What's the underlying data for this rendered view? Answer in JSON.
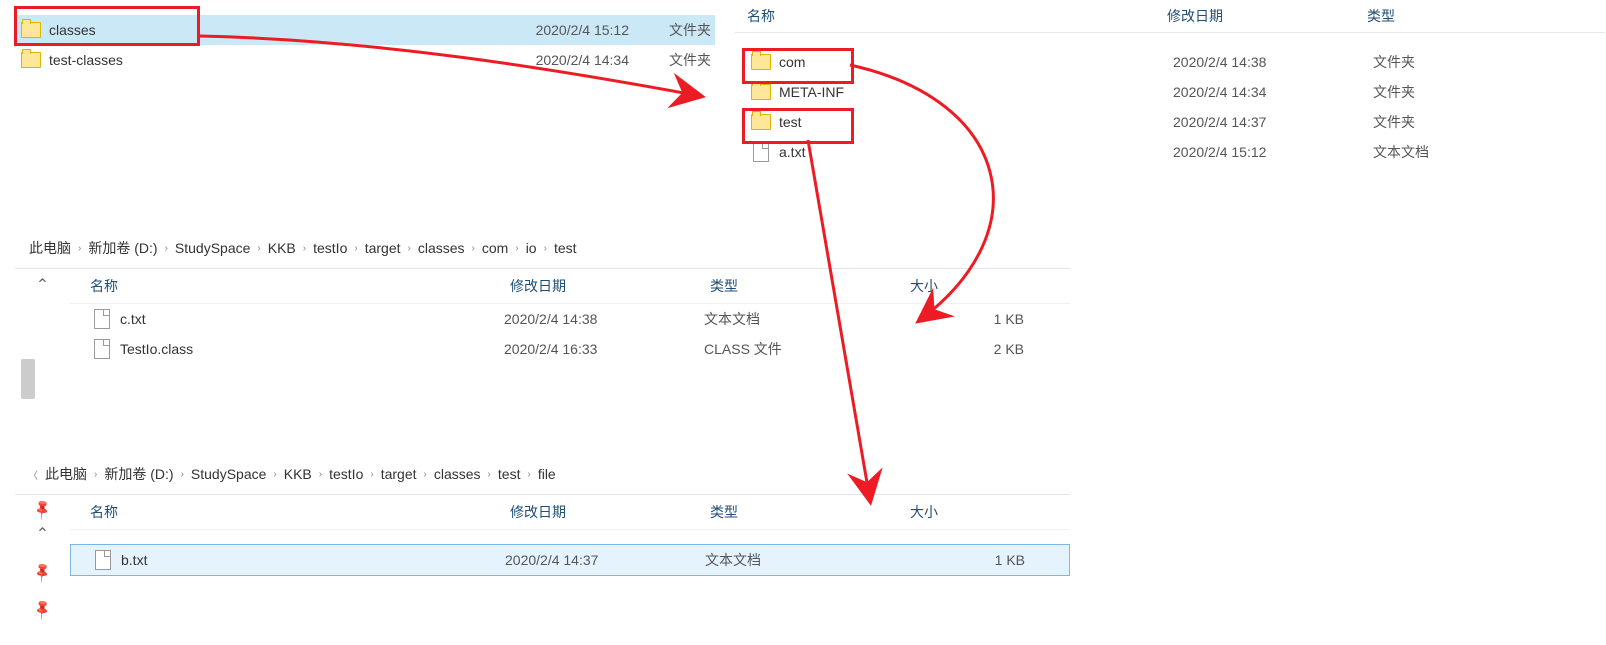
{
  "panel1": {
    "rows": [
      {
        "name": "classes",
        "date": "2020/2/4 15:12",
        "type": "文件夹",
        "icon": "folder",
        "selected": true
      },
      {
        "name": "test-classes",
        "date": "2020/2/4 14:34",
        "type": "文件夹",
        "icon": "folder",
        "selected": false
      }
    ]
  },
  "panel2": {
    "headers": {
      "name": "名称",
      "date": "修改日期",
      "type": "类型"
    },
    "rows": [
      {
        "name": "com",
        "date": "2020/2/4 14:38",
        "type": "文件夹",
        "icon": "folder"
      },
      {
        "name": "META-INF",
        "date": "2020/2/4 14:34",
        "type": "文件夹",
        "icon": "folder"
      },
      {
        "name": "test",
        "date": "2020/2/4 14:37",
        "type": "文件夹",
        "icon": "folder"
      },
      {
        "name": "a.txt",
        "date": "2020/2/4 15:12",
        "type": "文本文档",
        "icon": "file"
      }
    ]
  },
  "crumb1": [
    "此电脑",
    "新加卷 (D:)",
    "StudySpace",
    "KKB",
    "testIo",
    "target",
    "classes",
    "com",
    "io",
    "test"
  ],
  "panel3": {
    "headers": {
      "name": "名称",
      "date": "修改日期",
      "type": "类型",
      "size": "大小"
    },
    "rows": [
      {
        "name": "c.txt",
        "date": "2020/2/4 14:38",
        "type": "文本文档",
        "size": "1 KB",
        "icon": "file"
      },
      {
        "name": "TestIo.class",
        "date": "2020/2/4 16:33",
        "type": "CLASS 文件",
        "size": "2 KB",
        "icon": "file"
      }
    ]
  },
  "crumb2": [
    "此电脑",
    "新加卷 (D:)",
    "StudySpace",
    "KKB",
    "testIo",
    "target",
    "classes",
    "test",
    "file"
  ],
  "panel4": {
    "headers": {
      "name": "名称",
      "date": "修改日期",
      "type": "类型",
      "size": "大小"
    },
    "rows": [
      {
        "name": "b.txt",
        "date": "2020/2/4 14:37",
        "type": "文本文档",
        "size": "1 KB",
        "icon": "file",
        "selected": true
      }
    ]
  }
}
